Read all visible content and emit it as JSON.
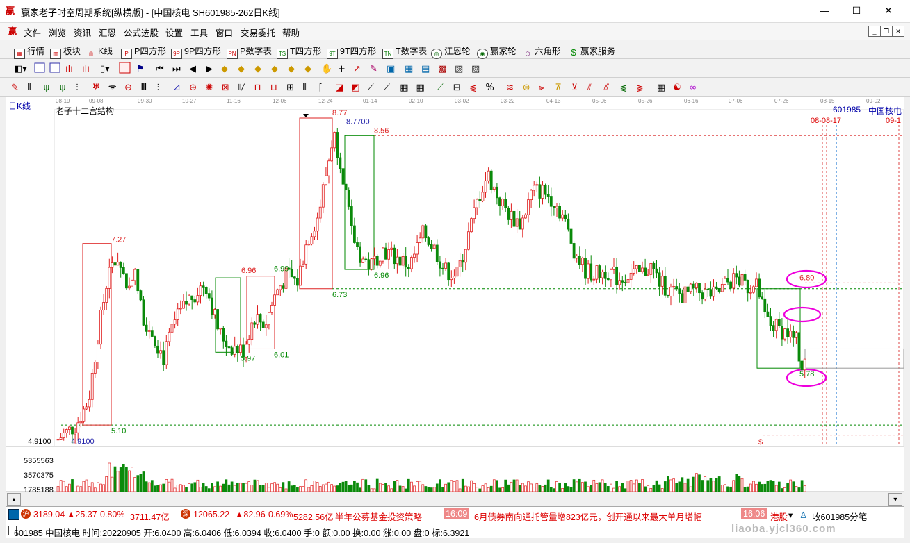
{
  "window": {
    "title": "赢家老子时空周期系统[纵横版] - [中国核电  SH601985-262日K线]",
    "minimize": "—",
    "maximize": "☐",
    "close": "✕"
  },
  "menu": [
    "文件",
    "浏览",
    "资讯",
    "汇恩",
    "公式选股",
    "设置",
    "工具",
    "窗口",
    "交易委托",
    "帮助"
  ],
  "toolbar1": [
    {
      "label": "行情",
      "icon": "grid-icon"
    },
    {
      "label": "板块",
      "icon": "blocks-icon"
    },
    {
      "label": "K线",
      "icon": "kline-icon"
    },
    {
      "label": "P四方形",
      "icon": "P"
    },
    {
      "label": "9P四方形",
      "icon": "9P"
    },
    {
      "label": "P数字表",
      "icon": "PN"
    },
    {
      "label": "T四方形",
      "icon": "TS"
    },
    {
      "label": "9T四方形",
      "icon": "9T"
    },
    {
      "label": "T数字表",
      "icon": "TN"
    },
    {
      "label": "江恩轮",
      "icon": "gann-wheel-icon"
    },
    {
      "label": "赢家轮",
      "icon": "winner-wheel-icon"
    },
    {
      "label": "六角形",
      "icon": "hexagon-icon"
    },
    {
      "label": "赢家服务",
      "icon": "dollar-icon"
    }
  ],
  "chart": {
    "period_label": "日K线",
    "indicator_name": "老子十二宫结构",
    "stock_code": "601985",
    "stock_name": "中国核电",
    "date_ticks": [
      "08-19",
      "09-08",
      "09-30",
      "10-27",
      "11-16",
      "12-06",
      "12-24",
      "01-14",
      "02-10",
      "03-02",
      "03-22",
      "04-13",
      "05-06",
      "05-26",
      "06-16",
      "07-06",
      "07-26",
      "08-15",
      "09-02"
    ],
    "future_dates": [
      "08-08-17",
      "09-1"
    ],
    "bottom_price": "4.9100",
    "price_labels": {
      "low_start": "4.9100",
      "high_8_77": "8.77",
      "high_8_7700": "8.7700",
      "level_8_56": "8.56",
      "level_7_27": "7.27",
      "level_6_96a": "6.96",
      "level_6_99": "6.99",
      "level_6_96b": "6.96",
      "level_6_73": "6.73",
      "level_6_80": "6.80",
      "level_5_97": "5.97",
      "level_6_01": "6.01",
      "level_5_78": "5.78",
      "level_5_10": "5.10",
      "dollar": "$"
    },
    "volume_axis": [
      "5355563",
      "3570375",
      "1785188"
    ]
  },
  "status": {
    "sh_index": "3189.04",
    "sh_change": "▲25.37",
    "sh_pct": "0.80%",
    "sh_amount": "3711.47亿",
    "sz_index": "12065.22",
    "sz_change": "▲82.96",
    "sz_pct": "0.69%",
    "sz_amount": "5282.56亿",
    "news1": "半年公募基金投资策略",
    "time1": "16:09",
    "news2": "6月债券南向通托管量增823亿元，创开通以来最大单月增幅",
    "time2": "16:06",
    "news3": "港股",
    "right_label": "收601985分笔"
  },
  "bottom_info": "601985 中国核电 时间:20220905 开:6.0400 高:6.0406 低:6.0394 收:6.0400 手:0 额:0.00 换:0.00 涨:0.00 盘:0 标:6.3921",
  "watermark": "liaoba.yjcl360.com"
}
